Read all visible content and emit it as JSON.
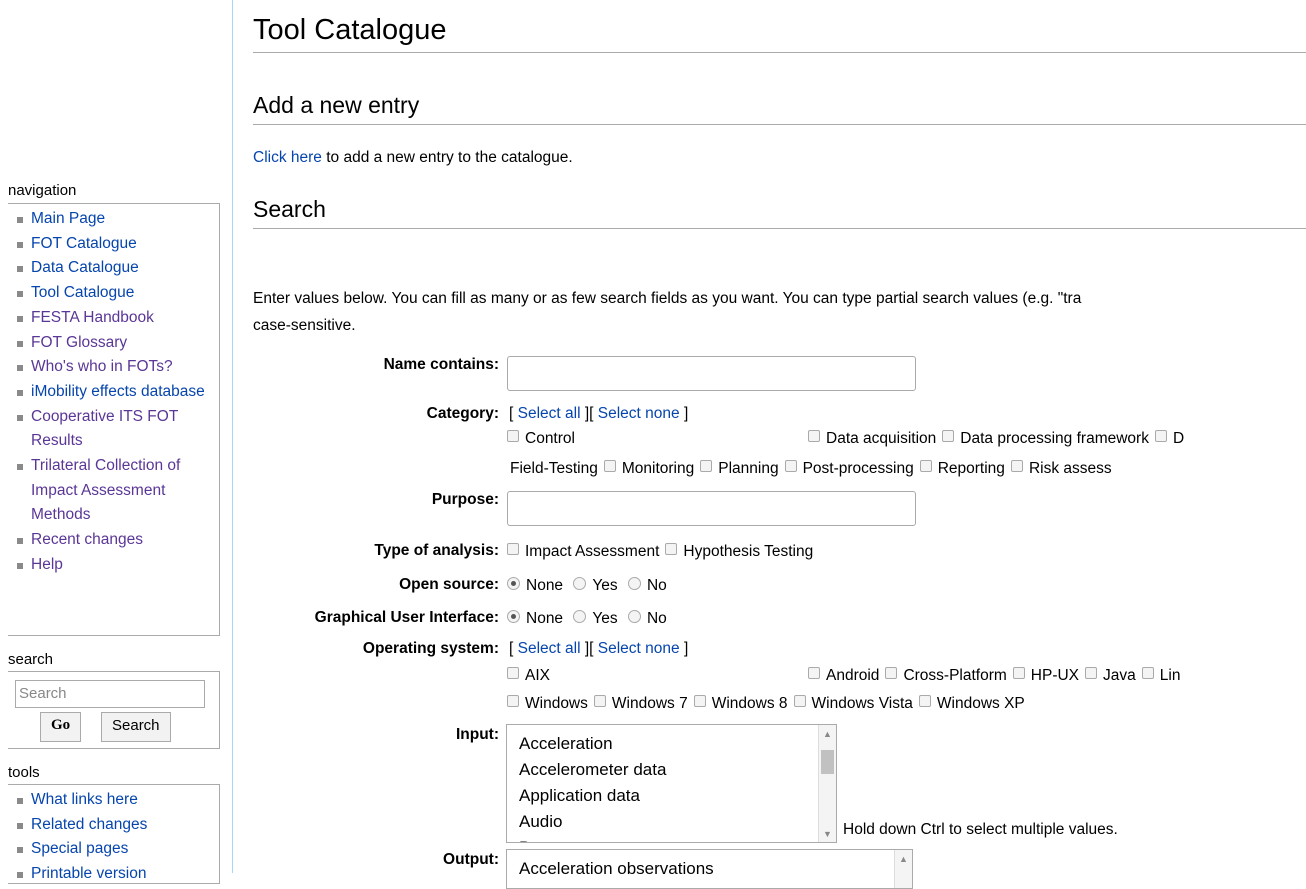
{
  "sidebar": {
    "navigation": {
      "title": "navigation",
      "items": [
        {
          "label": "Main Page"
        },
        {
          "label": "FOT Catalogue"
        },
        {
          "label": "Data Catalogue"
        },
        {
          "label": "Tool Catalogue"
        },
        {
          "label": "FESTA Handbook"
        },
        {
          "label": "FOT Glossary"
        },
        {
          "label": "Who's who in FOTs?"
        },
        {
          "label": "iMobility effects database"
        },
        {
          "label": "Cooperative ITS FOT Results"
        },
        {
          "label": "Trilateral Collection of Impact Assessment Methods"
        },
        {
          "label": "Recent changes"
        },
        {
          "label": "Help"
        }
      ]
    },
    "search": {
      "title": "search",
      "placeholder": "Search",
      "go_label": "Go",
      "search_label": "Search"
    },
    "tools": {
      "title": "tools",
      "items": [
        {
          "label": "What links here"
        },
        {
          "label": "Related changes"
        },
        {
          "label": "Special pages"
        },
        {
          "label": "Printable version"
        }
      ]
    }
  },
  "main": {
    "title": "Tool Catalogue",
    "add_section": {
      "heading": "Add a new entry",
      "link_text": "Click here",
      "rest_text": " to add a new entry to the catalogue."
    },
    "search_section": {
      "heading": "Search",
      "intro_line1": "Enter values below. You can fill as many or as few search fields as you want. You can type partial search values (e.g. \"tra",
      "intro_line2": "case-sensitive."
    },
    "form": {
      "name_label": "Name contains:",
      "category_label": "Category:",
      "select_all": "Select all",
      "select_none": "Select none",
      "category_row1": [
        "Control",
        "Data acquisition",
        "Data processing framework",
        "D"
      ],
      "category_row2": [
        "Field-Testing",
        "Monitoring",
        "Planning",
        "Post-processing",
        "Reporting",
        "Risk assess"
      ],
      "purpose_label": "Purpose:",
      "analysis_label": "Type of analysis:",
      "analysis_options": [
        "Impact Assessment",
        "Hypothesis Testing"
      ],
      "open_source_label": "Open source:",
      "gui_label": "Graphical User Interface:",
      "radio_options": [
        "None",
        "Yes",
        "No"
      ],
      "os_label": "Operating system:",
      "os_row1": [
        "AIX",
        "Android",
        "Cross-Platform",
        "HP-UX",
        "Java",
        "Lin"
      ],
      "os_row2": [
        "Windows",
        "Windows 7",
        "Windows 8",
        "Windows Vista",
        "Windows XP"
      ],
      "input_label": "Input:",
      "input_options": [
        "Acceleration",
        "Accelerometer data",
        "Application data",
        "Audio",
        "Batte"
      ],
      "multi_hint": "Hold down Ctrl to select multiple values.",
      "output_label": "Output:",
      "output_options": [
        "Acceleration observations"
      ]
    }
  }
}
